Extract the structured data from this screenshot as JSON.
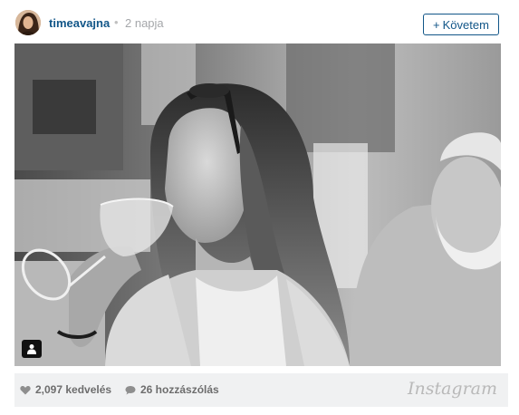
{
  "post": {
    "username": "timeavajna",
    "separator": "•",
    "time_ago": "2 napja",
    "follow_label": "Követem",
    "follow_prefix": "+"
  },
  "photo": {
    "style": "black-and-white",
    "icons": [
      "tag-people-icon"
    ]
  },
  "footer": {
    "likes": "2,097 kedvelés",
    "comments": "26 hozzászólás",
    "brand": "Instagram"
  },
  "icons": {
    "like": "heart-icon",
    "comment": "speech-bubble-icon"
  },
  "colors": {
    "username": "#125688",
    "follow_border": "#125688",
    "footer_bg": "#f0f1f2",
    "muted": "#a5a7aa"
  }
}
